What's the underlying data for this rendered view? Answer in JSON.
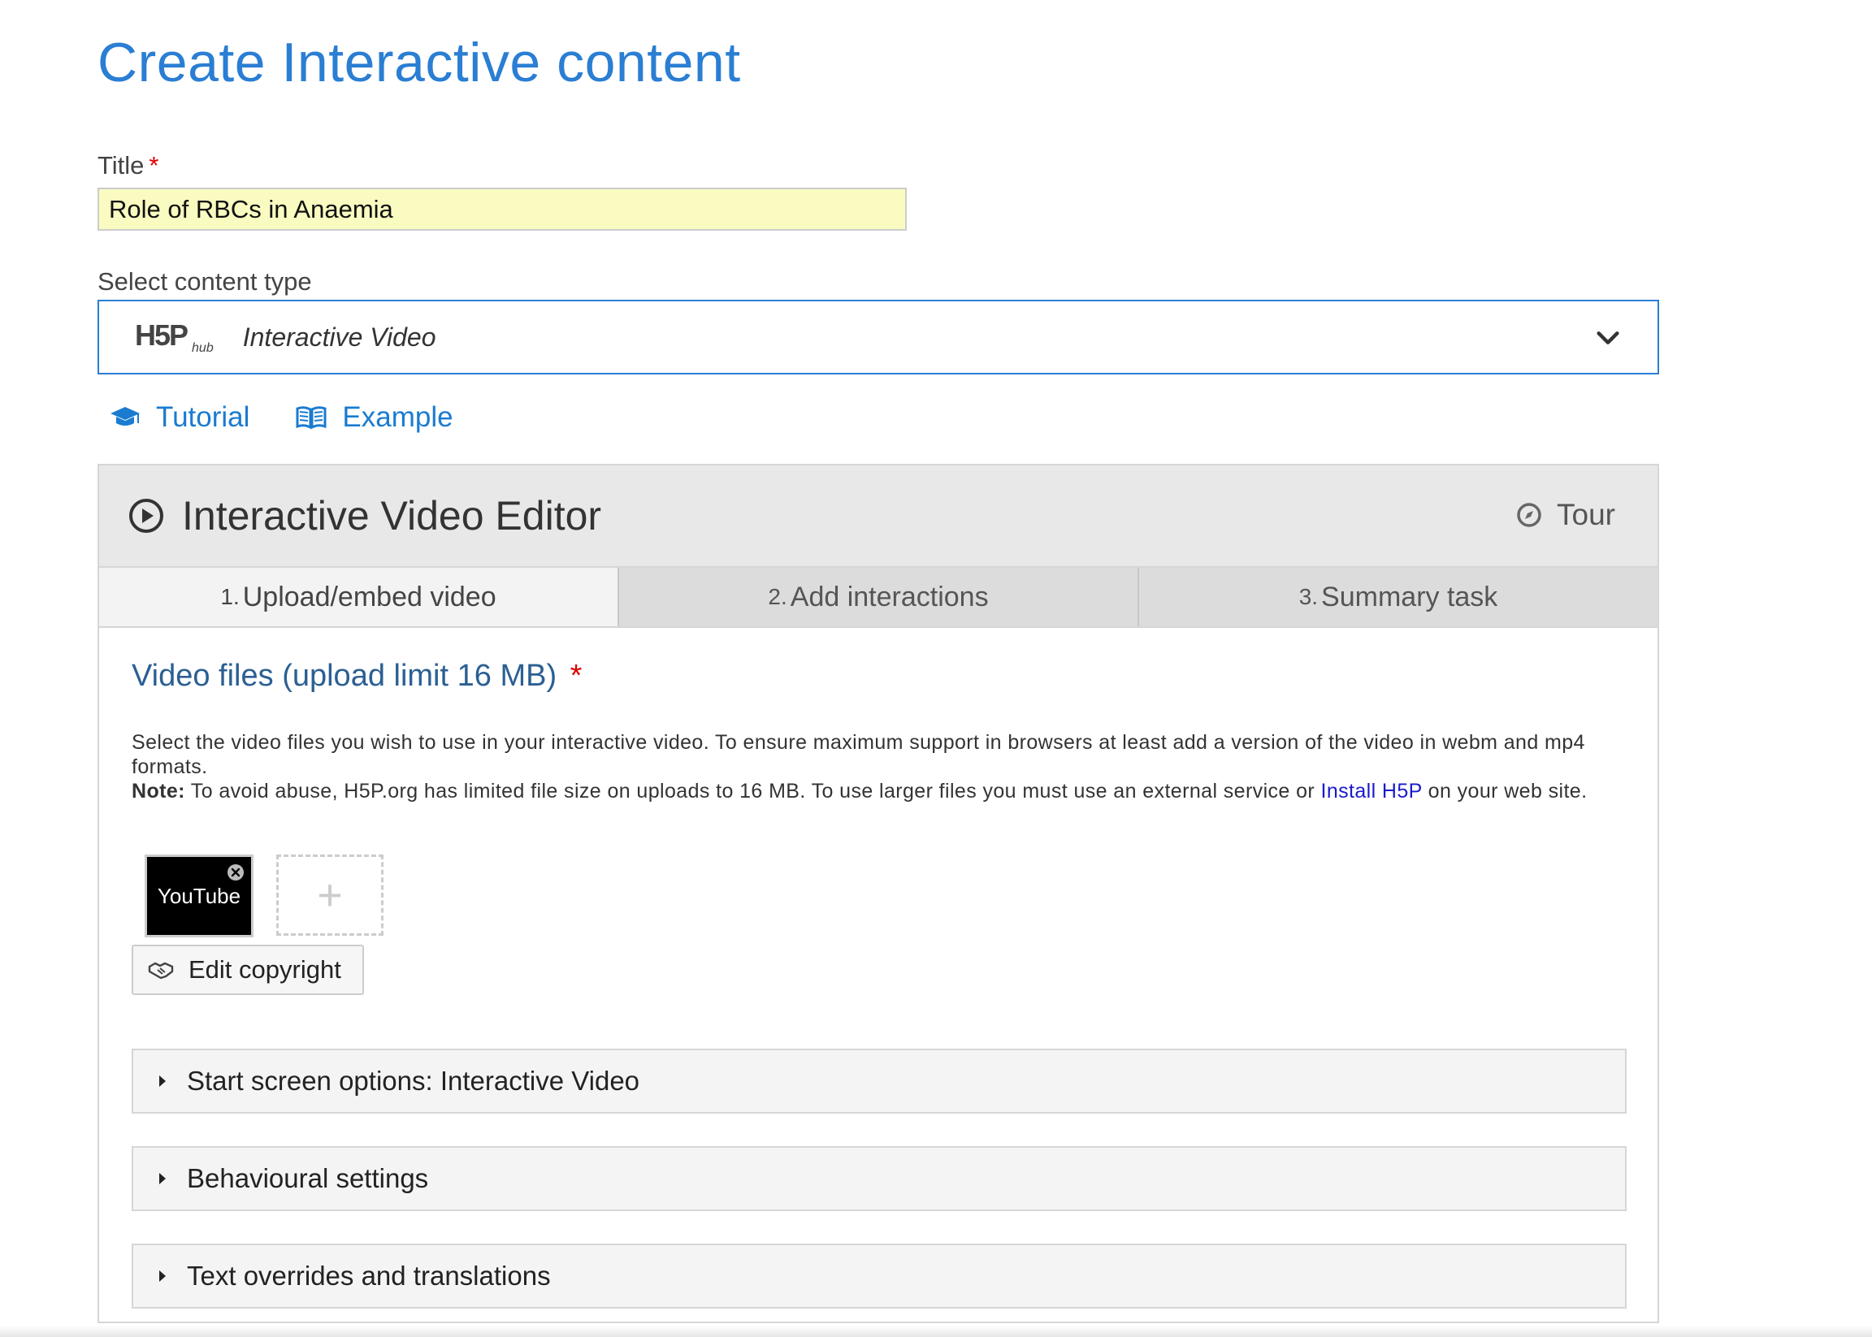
{
  "page": {
    "title": "Create Interactive content"
  },
  "title_field": {
    "label": "Title",
    "required_mark": "*",
    "value": "Role of RBCs in Anaemia"
  },
  "content_type": {
    "label": "Select content type",
    "logo_text": "H5P",
    "logo_sub": "hub",
    "value": "Interactive Video"
  },
  "links": {
    "tutorial": "Tutorial",
    "example": "Example"
  },
  "editor": {
    "title": "Interactive Video Editor",
    "tour_label": "Tour",
    "tabs": [
      {
        "num": "1.",
        "label": "Upload/embed video",
        "active": true
      },
      {
        "num": "2.",
        "label": "Add interactions",
        "active": false
      },
      {
        "num": "3.",
        "label": "Summary task",
        "active": false
      }
    ],
    "section_title": "Video files (upload limit 16 MB)",
    "section_required": "*",
    "description_1": "Select the video files you wish to use in your interactive video. To ensure maximum support in browsers at least add a version of the video in webm and mp4 formats.",
    "note_label": "Note:",
    "note_text": "To avoid abuse, H5P.org has limited file size on uploads to 16 MB. To use larger files you must use an external service or",
    "note_link": "Install H5P",
    "note_tail": "on your web site.",
    "thumb_label": "YouTube",
    "add_symbol": "+",
    "copyright_button": "Edit copyright",
    "groups": [
      "Start screen options: Interactive Video",
      "Behavioural settings",
      "Text overrides and translations"
    ]
  },
  "colors": {
    "accent": "#2a7ed3",
    "title_input_bg": "#f9fbc0",
    "section_title": "#2b5f93",
    "required": "#dd0000"
  }
}
